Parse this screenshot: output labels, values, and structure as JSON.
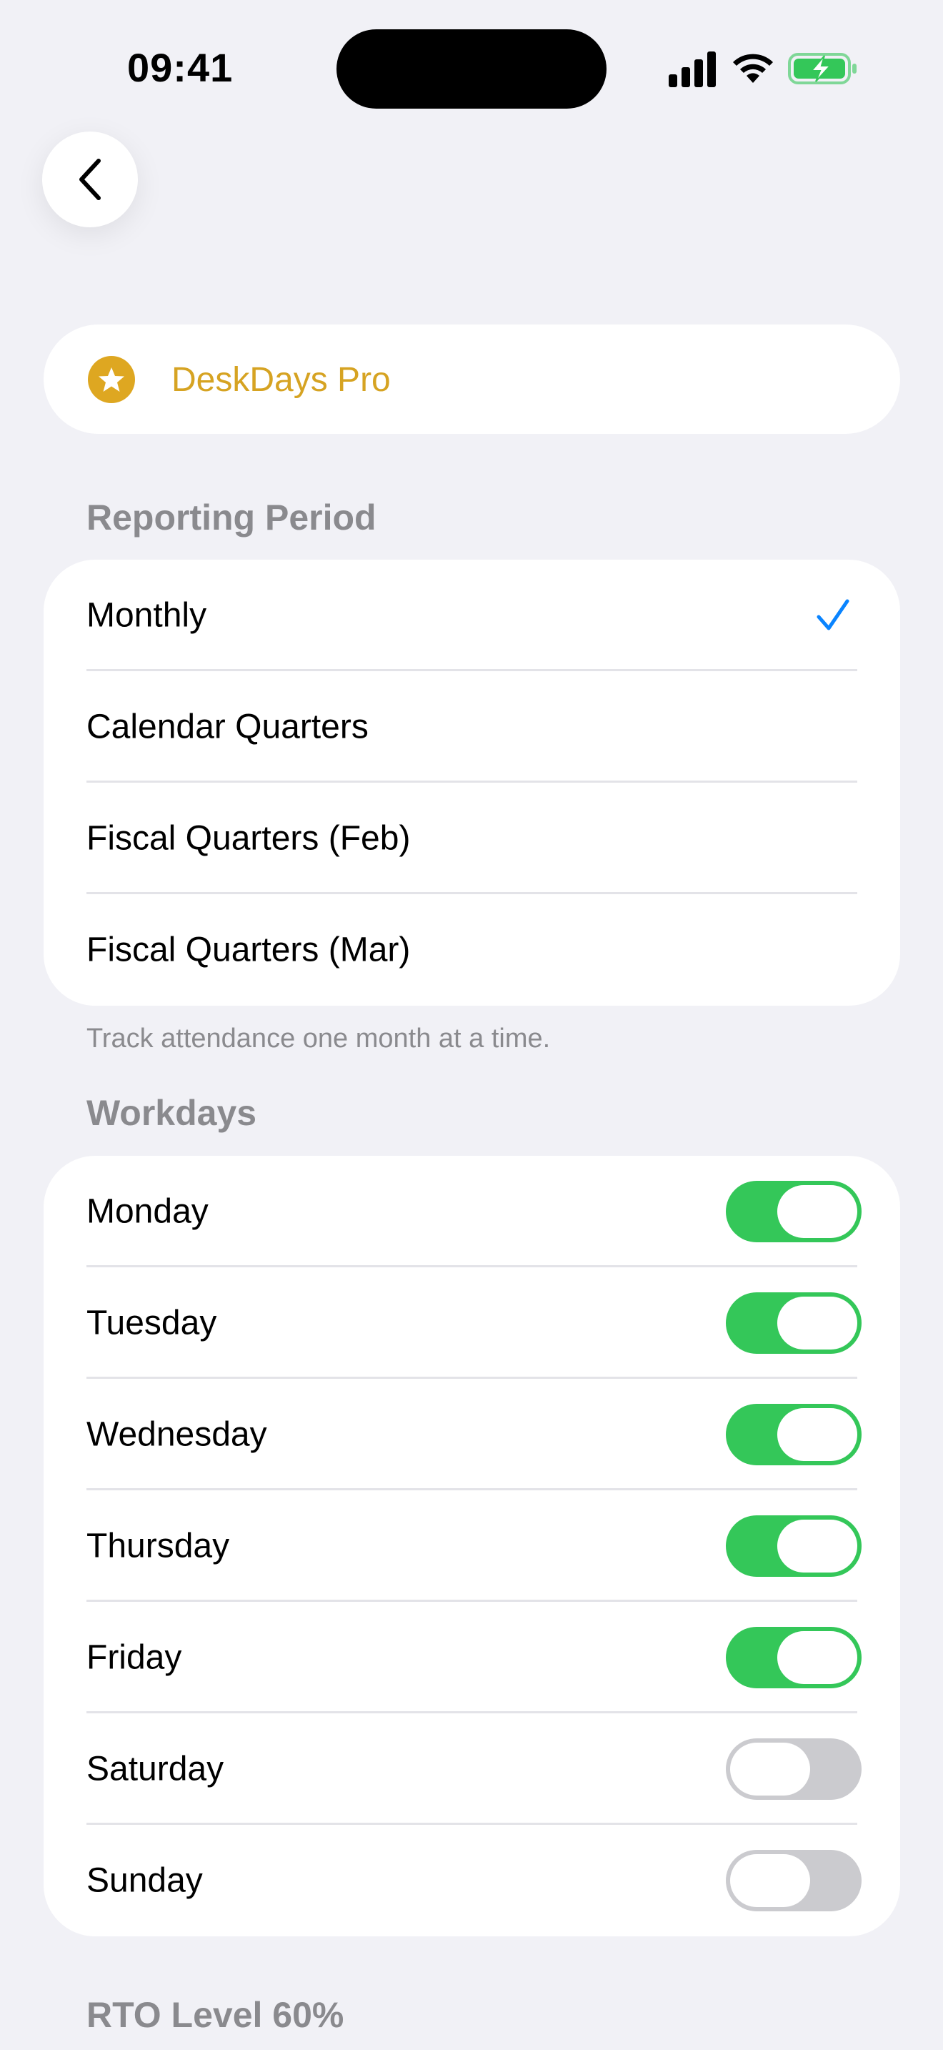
{
  "status_bar": {
    "time": "09:41",
    "icons": [
      "signal-icon",
      "wifi-icon",
      "battery-charging-icon"
    ]
  },
  "nav": {
    "back_icon": "chevron-left-icon"
  },
  "pro": {
    "label": "DeskDays Pro",
    "icon": "star-icon",
    "color": "#d6a322"
  },
  "reporting_period": {
    "header": "Reporting Period",
    "options": [
      {
        "label": "Monthly",
        "selected": true
      },
      {
        "label": "Calendar Quarters",
        "selected": false
      },
      {
        "label": "Fiscal Quarters (Feb)",
        "selected": false
      },
      {
        "label": "Fiscal Quarters (Mar)",
        "selected": false
      }
    ],
    "footnote": "Track attendance one month at a time.",
    "check_color": "#0a84ff"
  },
  "workdays": {
    "header": "Workdays",
    "days": [
      {
        "label": "Monday",
        "enabled": true
      },
      {
        "label": "Tuesday",
        "enabled": true
      },
      {
        "label": "Wednesday",
        "enabled": true
      },
      {
        "label": "Thursday",
        "enabled": true
      },
      {
        "label": "Friday",
        "enabled": true
      },
      {
        "label": "Saturday",
        "enabled": false
      },
      {
        "label": "Sunday",
        "enabled": false
      }
    ],
    "on_color": "#34c759",
    "off_color": "#cbcbcf"
  },
  "rto": {
    "header": "RTO Level 60%"
  }
}
